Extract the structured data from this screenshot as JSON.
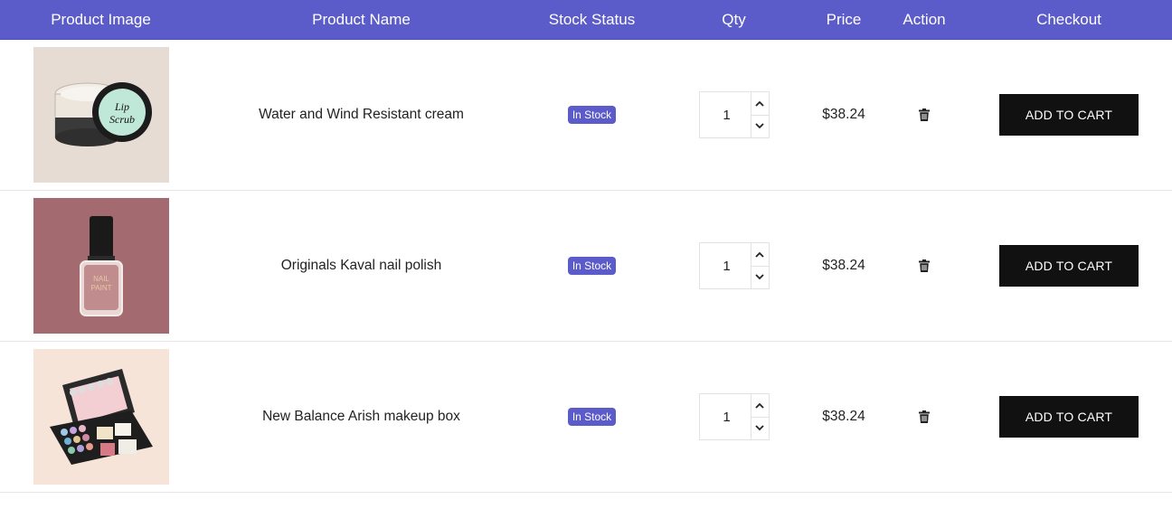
{
  "header": {
    "image": "Product Image",
    "name": "Product Name",
    "stock": "Stock Status",
    "qty": "Qty",
    "price": "Price",
    "action": "Action",
    "checkout": "Checkout"
  },
  "rows": [
    {
      "name": "Water and Wind Resistant cream",
      "stock": "In Stock",
      "qty": "1",
      "price": "$38.24",
      "cart_label": "ADD TO CART",
      "image_label": "Lip Scrub",
      "image_bg": "#e6dcd3"
    },
    {
      "name": "Originals Kaval nail polish",
      "stock": "In Stock",
      "qty": "1",
      "price": "$38.24",
      "cart_label": "ADD TO CART",
      "image_label": "NAIL PAINT",
      "image_bg": "#a36a70"
    },
    {
      "name": "New Balance Arish makeup box",
      "stock": "In Stock",
      "qty": "1",
      "price": "$38.24",
      "cart_label": "ADD TO CART",
      "image_label": "",
      "image_bg": "#f6e4d9"
    }
  ],
  "colors": {
    "header_bg": "#5b5bc9",
    "badge_bg": "#5b5bc9",
    "button_bg": "#111111"
  },
  "icons": {
    "delete": "trash-icon",
    "increment": "chevron-up-icon",
    "decrement": "chevron-down-icon"
  }
}
